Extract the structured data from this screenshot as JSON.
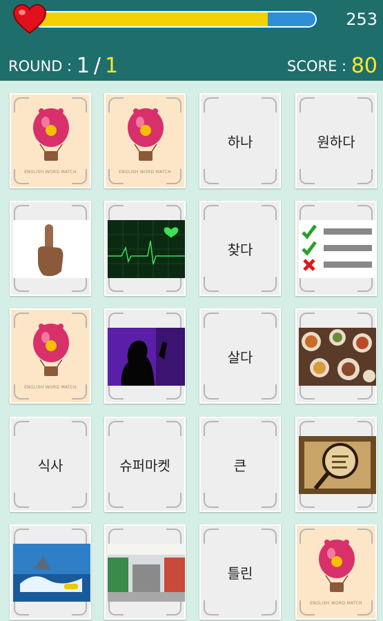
{
  "hud": {
    "time_left": "253",
    "progress_fraction": 0.83,
    "round_label": "ROUND :",
    "round_current": "1",
    "round_total": "1",
    "score_label": "SCORE :",
    "score_value": "80"
  },
  "cards": {
    "back_caption": "ENGLISH WORD MATCH",
    "words": [
      "하나",
      "원하다",
      "찾다",
      "살다",
      "식사",
      "슈퍼마켓",
      "큰",
      "틀린"
    ],
    "pictures": [
      "finger-pointing-up",
      "heart-monitor",
      "checklist",
      "silhouette-singing",
      "food-table",
      "magnifying-glass-paper",
      "shark-jetski",
      "supermarket-aisle"
    ]
  },
  "colors": {
    "header": "#1e6e6c",
    "background": "#d6efe6",
    "accent_yellow": "#ffe72a",
    "bar_fill": "#f3d000",
    "bar_empty": "#2e8fd6"
  }
}
